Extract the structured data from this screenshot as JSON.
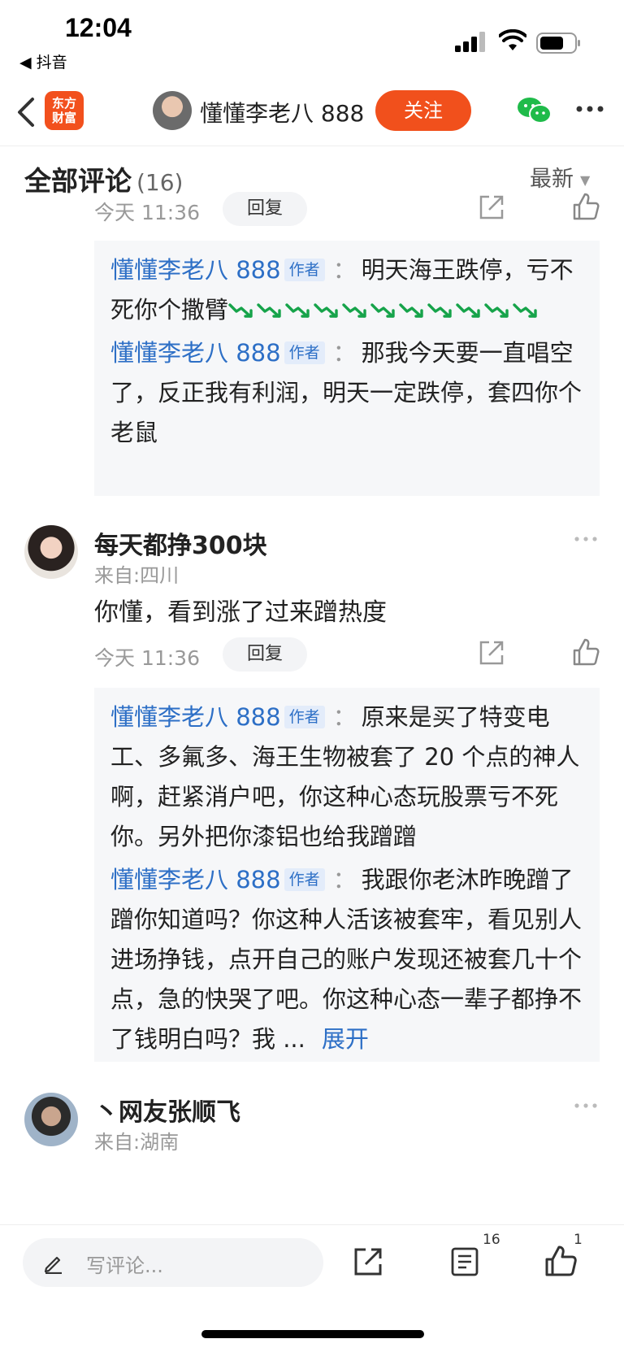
{
  "status_bar": {
    "time": "12:04",
    "back_app": "◀ 抖音"
  },
  "nav": {
    "brand_line1": "东方",
    "brand_line2": "财富",
    "username": "懂懂李老八 888",
    "follow_label": "关注"
  },
  "comments_header": {
    "title": "全部评论",
    "count": "(16)",
    "sort_label": "最新"
  },
  "thread1": {
    "time": "今天 11:36",
    "reply_label": "回复",
    "replies": [
      {
        "author": "懂懂李老八 888",
        "tag": "作者",
        "colon": "：",
        "text": "明天海王跌停，亏不死你个撒臂",
        "emoji_count": 11
      },
      {
        "author": "懂懂李老八 888",
        "tag": "作者",
        "colon": "：",
        "text": "那我今天要一直唱空了，反正我有利润，明天一定跌停，套四你个老鼠"
      }
    ]
  },
  "comment2": {
    "user": "每天都挣300块",
    "location": "来自:四川",
    "text": "你懂，看到涨了过来蹭热度",
    "time": "今天 11:36",
    "reply_label": "回复",
    "replies": [
      {
        "author": "懂懂李老八 888",
        "tag": "作者",
        "colon": "：",
        "text": "原来是买了特变电工、多氟多、海王生物被套了 20 个点的神人啊，赶紧消户吧，你这种心态玩股票亏不死你。另外把你漆铝也给我蹭蹭"
      },
      {
        "author": "懂懂李老八 888",
        "tag": "作者",
        "colon": "：",
        "text": "我跟你老沐昨晚蹭了蹭你知道吗？你这种人活该被套牢，看见别人进场挣钱，点开自己的账户发现还被套几十个点，急的快哭了吧。你这种心态一辈子都挣不了钱明白吗？我 ...",
        "expand": "展开"
      }
    ]
  },
  "comment3": {
    "user": "丶网友张顺飞",
    "location": "来自:湖南"
  },
  "bottom_bar": {
    "placeholder": "写评论...",
    "list_count": "16",
    "like_count": "1"
  },
  "colors": {
    "accent": "#f1501c",
    "link": "#2d6fc6",
    "author_tag_bg": "#e3ecfa",
    "reply_bg": "#f6f7f9"
  }
}
